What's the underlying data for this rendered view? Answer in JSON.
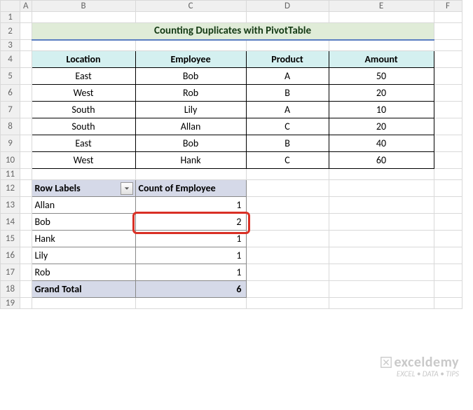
{
  "columns": [
    "A",
    "B",
    "C",
    "D",
    "E",
    "F"
  ],
  "rows": [
    "1",
    "2",
    "3",
    "4",
    "5",
    "6",
    "7",
    "8",
    "9",
    "10",
    "11",
    "12",
    "13",
    "14",
    "15",
    "16",
    "17",
    "18",
    "19"
  ],
  "title": "Counting Duplicates with PivotTable",
  "table1": {
    "headers": [
      "Location",
      "Employee",
      "Product",
      "Amount"
    ],
    "data": [
      [
        "East",
        "Bob",
        "A",
        "50"
      ],
      [
        "West",
        "Rob",
        "B",
        "20"
      ],
      [
        "South",
        "Lily",
        "A",
        "10"
      ],
      [
        "South",
        "Allan",
        "C",
        "20"
      ],
      [
        "East",
        "Bob",
        "B",
        "40"
      ],
      [
        "West",
        "Hank",
        "C",
        "60"
      ]
    ]
  },
  "pivot": {
    "row_labels_header": "Row Labels",
    "count_header": "Count of Employee",
    "rows": [
      {
        "label": "Allan",
        "count": "1"
      },
      {
        "label": "Bob",
        "count": "2"
      },
      {
        "label": "Hank",
        "count": "1"
      },
      {
        "label": "Lily",
        "count": "1"
      },
      {
        "label": "Rob",
        "count": "1"
      }
    ],
    "grand_total_label": "Grand Total",
    "grand_total_value": "6"
  },
  "watermark": {
    "brand": "exceldemy",
    "tagline": "EXCEL • DATA • TIPS"
  },
  "chart_data": {
    "type": "table",
    "title": "Counting Duplicates with PivotTable",
    "source_table": {
      "columns": [
        "Location",
        "Employee",
        "Product",
        "Amount"
      ],
      "rows": [
        [
          "East",
          "Bob",
          "A",
          50
        ],
        [
          "West",
          "Rob",
          "B",
          20
        ],
        [
          "South",
          "Lily",
          "A",
          10
        ],
        [
          "South",
          "Allan",
          "C",
          20
        ],
        [
          "East",
          "Bob",
          "B",
          40
        ],
        [
          "West",
          "Hank",
          "C",
          60
        ]
      ]
    },
    "pivot_table": {
      "row_field": "Employee",
      "value_field": "Count of Employee",
      "rows": [
        {
          "Employee": "Allan",
          "Count": 1
        },
        {
          "Employee": "Bob",
          "Count": 2
        },
        {
          "Employee": "Hank",
          "Count": 1
        },
        {
          "Employee": "Lily",
          "Count": 1
        },
        {
          "Employee": "Rob",
          "Count": 1
        }
      ],
      "grand_total": 6,
      "highlighted_cell": {
        "row": "Bob",
        "value": 2
      }
    }
  }
}
